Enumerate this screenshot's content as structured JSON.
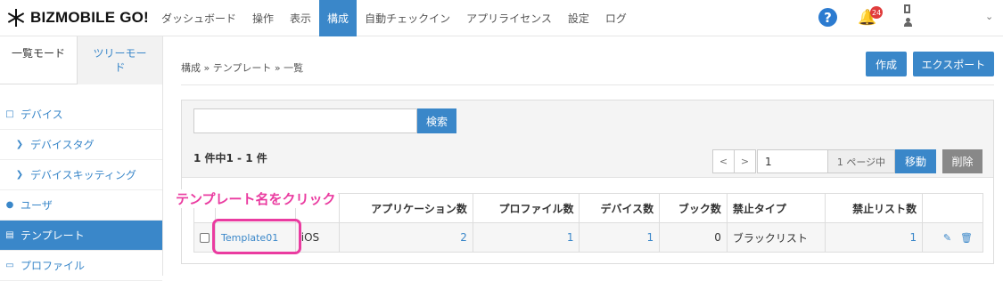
{
  "app": {
    "brand": "BIZMOBILE GO!"
  },
  "nav": {
    "items": [
      "ダッシュボード",
      "操作",
      "表示",
      "構成",
      "自動チェックイン",
      "アプリライセンス",
      "設定",
      "ログ"
    ],
    "active": "構成",
    "notification_count": "24",
    "help_icon": "question-circle-icon",
    "bell_icon": "bell-icon"
  },
  "sidebar": {
    "tabs": [
      "一覧モード",
      "ツリーモード"
    ],
    "items": [
      {
        "label": "デバイス",
        "icon": "square-icon",
        "level": 0
      },
      {
        "label": "デバイスタグ",
        "icon": "chevron-right-icon",
        "level": 1
      },
      {
        "label": "デバイスキッティング",
        "icon": "chevron-right-icon",
        "level": 1
      },
      {
        "label": "ユーザ",
        "icon": "user-icon",
        "level": 0
      },
      {
        "label": "テンプレート",
        "icon": "file-icon",
        "level": 0,
        "active": true
      },
      {
        "label": "プロファイル",
        "icon": "hdd-icon",
        "level": 0
      }
    ]
  },
  "page": {
    "breadcrumb": "構成 » テンプレート » 一覧",
    "create_label": "作成",
    "export_label": "エクスポート"
  },
  "search": {
    "value": "",
    "button_label": "検索"
  },
  "pagination": {
    "count_text": "1 件中1 - 1 件",
    "prev": "<",
    "next": ">",
    "page_value": "1",
    "page_suffix": "1 ページ中",
    "move_label": "移動",
    "delete_label": "削除"
  },
  "table": {
    "headers": [
      "",
      "",
      "",
      "アプリケーション数",
      "プロファイル数",
      "デバイス数",
      "ブック数",
      "禁止タイプ",
      "禁止リスト数",
      ""
    ],
    "rows": [
      {
        "name": "Template01",
        "os": "iOS",
        "apps": "2",
        "profiles": "1",
        "devices": "1",
        "books": "0",
        "ban_type": "ブラックリスト",
        "ban_count": "1"
      }
    ]
  },
  "annotation": {
    "label": "テンプレート名をクリック",
    "color": "#ea3ba0"
  },
  "colors": {
    "primary": "#3a87c9",
    "danger_badge": "#e03c3c",
    "delete_button": "#888888"
  }
}
